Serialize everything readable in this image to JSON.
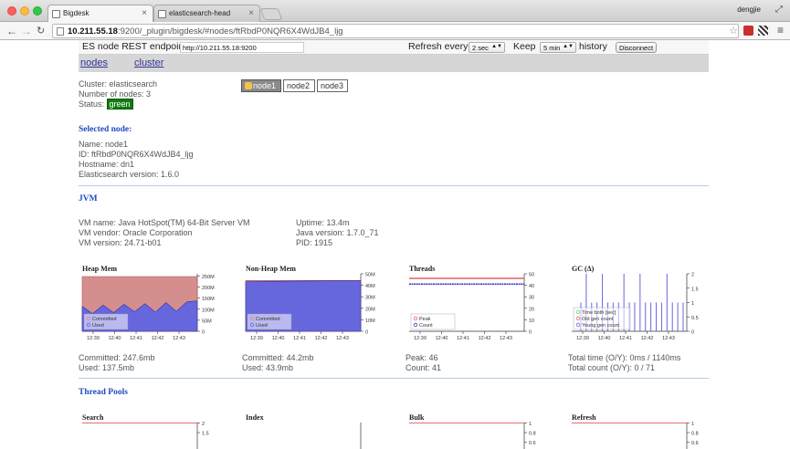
{
  "browser": {
    "tabs": [
      {
        "label": "Bigdesk",
        "active": true
      },
      {
        "label": "elasticsearch-head",
        "active": false
      }
    ],
    "user": "dengjie",
    "url_host": "10.211.55.18",
    "url_rest": ":9200/_plugin/bigdesk/#nodes/ftRbdP0NQR6X4WdJB4_ljg"
  },
  "header": {
    "endpoint_label": "ES node REST endpoint",
    "endpoint_value": "http://10.211.55.18:9200",
    "refresh_label": "Refresh every",
    "refresh_value": "2 sec",
    "keep_label": "Keep",
    "keep_value": "5 min",
    "history_label": "history",
    "disconnect_label": "Disconnect"
  },
  "nav": {
    "nodes": "nodes",
    "cluster": "cluster"
  },
  "cluster": {
    "name_line": "Cluster: elasticsearch",
    "nodes_line": "Number of nodes: 3",
    "status_label": "Status:",
    "status_value": "green",
    "node_buttons": [
      "node1",
      "node2",
      "node3"
    ]
  },
  "selected_node": {
    "title": "Selected node:",
    "name": "Name: node1",
    "id": "ID: ftRbdP0NQR6X4WdJB4_ljg",
    "hostname": "Hostname: dn1",
    "version": "Elasticsearch version: 1.6.0"
  },
  "jvm": {
    "title": "JVM",
    "vm_name": "VM name: Java HotSpot(TM) 64-Bit Server VM",
    "vm_vendor": "VM vendor: Oracle Corporation",
    "vm_version": "VM version: 24.71-b01",
    "uptime": "Uptime: 13.4m",
    "java_version": "Java version: 1.7.0_71",
    "pid": "PID: 1915"
  },
  "colors": {
    "committed": "#d58e8e",
    "used": "#6666dd",
    "peak": "#e36e6e",
    "count": "#3d3dc0"
  },
  "chart_data": [
    {
      "type": "area",
      "title": "Heap Mem",
      "x_ticks": [
        "12:39",
        "12:40",
        "12:41",
        "12:42",
        "12:43"
      ],
      "y_ticks": [
        "0",
        "50M",
        "100M",
        "150M",
        "200M",
        "250M"
      ],
      "ylim": [
        0,
        260
      ],
      "legend_placement": "bottom-left",
      "series": [
        {
          "name": "Committed",
          "values": [
            247.6,
            247.6,
            247.6,
            247.6,
            247.6,
            247.6,
            247.6,
            247.6,
            247.6,
            247.6,
            247.6,
            247.6
          ]
        },
        {
          "name": "Used",
          "values": [
            112,
            80,
            118,
            84,
            122,
            88,
            125,
            86,
            130,
            90,
            133,
            137.5
          ]
        }
      ],
      "footer": [
        "Committed: 247.6mb",
        "Used: 137.5mb"
      ]
    },
    {
      "type": "area",
      "title": "Non-Heap Mem",
      "x_ticks": [
        "12:39",
        "12:40",
        "12:41",
        "12:42",
        "12:43"
      ],
      "y_ticks": [
        "0",
        "10M",
        "20M",
        "30M",
        "40M",
        "50M"
      ],
      "ylim": [
        0,
        50
      ],
      "legend_placement": "bottom-left",
      "series": [
        {
          "name": "Committed",
          "values": [
            44.2,
            44.2,
            44.2,
            44.2,
            44.2,
            44.2
          ]
        },
        {
          "name": "Used",
          "values": [
            43.0,
            43.4,
            43.6,
            43.8,
            43.9,
            43.9
          ]
        }
      ],
      "footer": [
        "Committed: 44.2mb",
        "Used: 43.9mb"
      ]
    },
    {
      "type": "line",
      "title": "Threads",
      "x_ticks": [
        "12:39",
        "12:40",
        "12:41",
        "12:42",
        "12:43"
      ],
      "y_ticks": [
        "0",
        "10",
        "20",
        "30",
        "40",
        "50"
      ],
      "ylim": [
        0,
        50
      ],
      "legend_placement": "bottom-left",
      "series": [
        {
          "name": "Peak",
          "values": [
            46,
            46,
            46,
            46,
            46,
            46
          ]
        },
        {
          "name": "Count",
          "values": [
            41,
            41,
            41,
            41,
            41,
            41
          ]
        }
      ],
      "footer": [
        "Peak: 46",
        "Count: 41"
      ]
    },
    {
      "type": "bar",
      "title": "GC (Δ)",
      "x_ticks": [
        "12:39",
        "12:40",
        "12:41",
        "12:42",
        "12:43"
      ],
      "y_ticks": [
        "0",
        "0.5",
        "1",
        "1.5",
        "2"
      ],
      "ylim": [
        0,
        2
      ],
      "legend_placement": "bottom-left",
      "series": [
        {
          "name": "Time both [sec]",
          "values": []
        },
        {
          "name": "Old gen count",
          "values": []
        },
        {
          "name": "Young gen count",
          "values": [
            1,
            2,
            1,
            1,
            2,
            1,
            1,
            1,
            2,
            1,
            1,
            2,
            1,
            1,
            1,
            1,
            2,
            1,
            1,
            1
          ]
        }
      ],
      "footer": [
        "Total time (O/Y): 0ms / 1140ms",
        "Total count (O/Y): 0 / 71"
      ]
    }
  ],
  "thread_pools": {
    "title": "Thread Pools",
    "charts": [
      {
        "title": "Search",
        "y_ticks": [
          "2",
          "1.5"
        ]
      },
      {
        "title": "Index",
        "y_ticks": []
      },
      {
        "title": "Bulk",
        "y_ticks": [
          "1",
          "0.8",
          "0.6"
        ]
      },
      {
        "title": "Refresh",
        "y_ticks": [
          "1",
          "0.8",
          "0.6"
        ]
      }
    ]
  }
}
